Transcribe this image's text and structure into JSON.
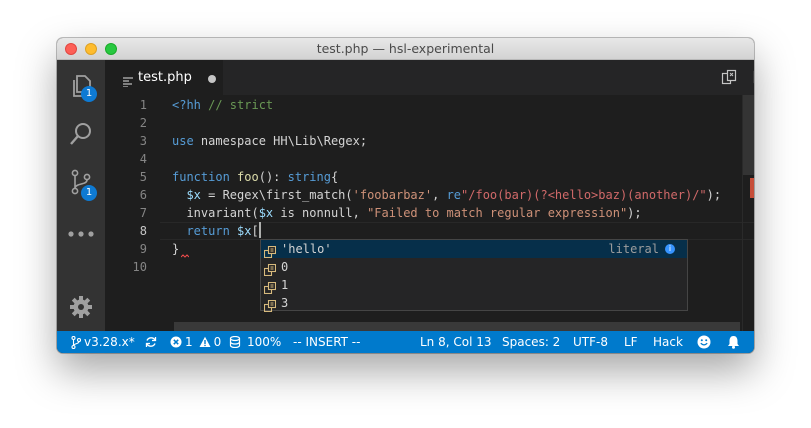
{
  "window": {
    "title": "test.php — hsl-experimental"
  },
  "activity_bar": {
    "explorer_badge": "1",
    "scm_badge": "1"
  },
  "tab": {
    "label": "test.php",
    "dirty": true
  },
  "editor": {
    "current_line": 8,
    "lines": [
      {
        "num": "1",
        "tokens": [
          {
            "t": "<?hh ",
            "c": "kw"
          },
          {
            "t": "// strict",
            "c": "cm"
          }
        ]
      },
      {
        "num": "2",
        "tokens": []
      },
      {
        "num": "3",
        "tokens": [
          {
            "t": "use",
            "c": "kw"
          },
          {
            "t": " namespace HH\\Lib\\Regex;",
            "c": "plain"
          }
        ]
      },
      {
        "num": "4",
        "tokens": []
      },
      {
        "num": "5",
        "tokens": [
          {
            "t": "function",
            "c": "kw"
          },
          {
            "t": " ",
            "c": "plain"
          },
          {
            "t": "foo",
            "c": "fn"
          },
          {
            "t": "(): ",
            "c": "plain"
          },
          {
            "t": "string",
            "c": "kw"
          },
          {
            "t": "{",
            "c": "plain"
          }
        ]
      },
      {
        "num": "6",
        "tokens": [
          {
            "t": "  ",
            "c": "plain"
          },
          {
            "t": "$x",
            "c": "var"
          },
          {
            "t": " = Regex\\first_match(",
            "c": "plain"
          },
          {
            "t": "'foobarbaz'",
            "c": "str"
          },
          {
            "t": ", ",
            "c": "plain"
          },
          {
            "t": "re",
            "c": "kw"
          },
          {
            "t": "\"/foo(bar)(?<hello>baz)(another)/\"",
            "c": "re"
          },
          {
            "t": ");",
            "c": "plain"
          }
        ]
      },
      {
        "num": "7",
        "tokens": [
          {
            "t": "  invariant(",
            "c": "plain"
          },
          {
            "t": "$x",
            "c": "var"
          },
          {
            "t": " is nonnull, ",
            "c": "plain"
          },
          {
            "t": "\"Failed to match regular expression\"",
            "c": "str"
          },
          {
            "t": ");",
            "c": "plain"
          }
        ]
      },
      {
        "num": "8",
        "tokens": [
          {
            "t": "  ",
            "c": "plain"
          },
          {
            "t": "return",
            "c": "kw"
          },
          {
            "t": " ",
            "c": "plain"
          },
          {
            "t": "$x",
            "c": "var"
          },
          {
            "t": "[",
            "c": "plain"
          }
        ]
      },
      {
        "num": "9",
        "tokens": [
          {
            "t": "}",
            "c": "plain"
          }
        ]
      },
      {
        "num": "10",
        "tokens": []
      }
    ]
  },
  "suggest": {
    "items": [
      {
        "label": "'hello'",
        "detail": "literal",
        "selected": true
      },
      {
        "label": "0",
        "detail": "",
        "selected": false
      },
      {
        "label": "1",
        "detail": "",
        "selected": false
      },
      {
        "label": "3",
        "detail": "",
        "selected": false
      }
    ]
  },
  "status_bar": {
    "branch": "v3.28.x*",
    "errors": "1",
    "warnings": "0",
    "zoom": "100%",
    "mode": "-- INSERT --",
    "position": "Ln 8, Col 13",
    "spaces": "Spaces: 2",
    "encoding": "UTF-8",
    "eol": "LF",
    "language": "Hack"
  },
  "colors": {
    "status_bar": "#007acc",
    "activity_bar": "#333333",
    "editor_bg": "#1e1e1e",
    "badge": "#0e7ad3"
  },
  "icons": [
    "explorer-icon",
    "search-icon",
    "source-control-icon",
    "more-icon",
    "settings-gear-icon",
    "php-file-icon",
    "open-changes-icon",
    "split-editor-icon",
    "more-actions-icon",
    "git-branch-icon",
    "sync-icon",
    "error-icon",
    "warning-icon",
    "zoom-icon",
    "feedback-smiley-icon",
    "notifications-bell-icon",
    "variable-symbol-icon"
  ]
}
